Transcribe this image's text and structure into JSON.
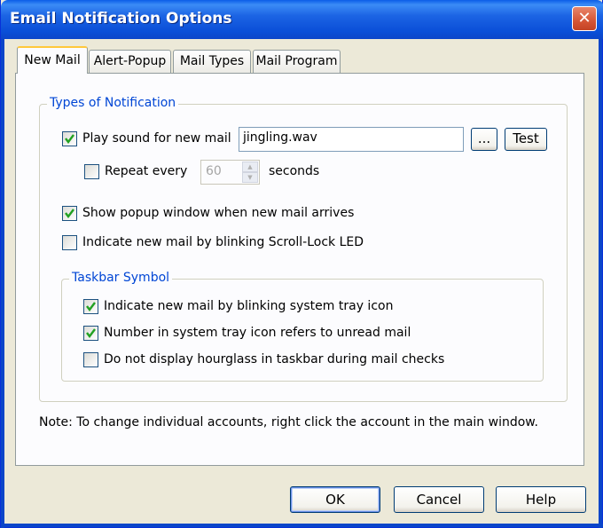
{
  "window": {
    "title": "Email Notification Options"
  },
  "tabs": [
    {
      "label": "New Mail",
      "active": true
    },
    {
      "label": "Alert-Popup",
      "active": false
    },
    {
      "label": "Mail Types",
      "active": false
    },
    {
      "label": "Mail Program",
      "active": false
    }
  ],
  "types_group": {
    "legend": "Types of Notification",
    "play_sound": {
      "label": "Play sound for new mail",
      "checked": true,
      "file": "jingling.wav",
      "browse_label": "...",
      "test_label": "Test"
    },
    "repeat": {
      "label": "Repeat every",
      "checked": false,
      "value": "60",
      "unit": "seconds"
    },
    "popup": {
      "label": "Show popup window when new mail arrives",
      "checked": true
    },
    "scroll_lock": {
      "label": "Indicate new mail by blinking Scroll-Lock LED",
      "checked": false
    }
  },
  "taskbar_group": {
    "legend": "Taskbar Symbol",
    "blink_tray": {
      "label": "Indicate new mail by blinking system tray icon",
      "checked": true
    },
    "unread_count": {
      "label": "Number in system tray icon refers to unread mail",
      "checked": true
    },
    "no_hourglass": {
      "label": "Do not display hourglass in taskbar during mail checks",
      "checked": false
    }
  },
  "note": "Note: To change individual accounts, right click the account in the main window.",
  "buttons": {
    "ok": "OK",
    "cancel": "Cancel",
    "help": "Help"
  },
  "colors": {
    "accent": "#0046d5",
    "title_bar": "#0a5ce8",
    "close": "#d65535",
    "tab_highlight": "#ffc83c"
  }
}
